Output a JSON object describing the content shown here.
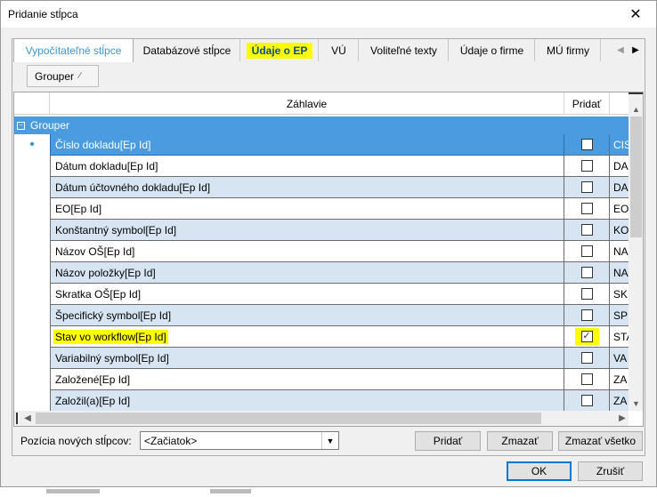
{
  "window": {
    "title": "Pridanie stĺpca"
  },
  "tabs": [
    {
      "label": "Vypočítateľné stĺpce"
    },
    {
      "label": "Databázové stĺpce"
    },
    {
      "label": "Údaje o EP"
    },
    {
      "label": "VÚ"
    },
    {
      "label": "Voliteľné texty"
    },
    {
      "label": "Údaje o firme"
    },
    {
      "label": "MÚ firmy"
    }
  ],
  "grouper_chip": {
    "label": "Grouper"
  },
  "grid": {
    "columns": {
      "header": "Záhlavie",
      "add": "Pridať"
    },
    "group_name": "Grouper",
    "rows": [
      {
        "header": "Číslo dokladu[Ep Id]",
        "code": "CIS",
        "checked": false
      },
      {
        "header": "Dátum dokladu[Ep Id]",
        "code": "DA",
        "checked": false
      },
      {
        "header": "Dátum účtovného dokladu[Ep Id]",
        "code": "DA",
        "checked": false
      },
      {
        "header": "EO[Ep Id]",
        "code": "EO",
        "checked": false
      },
      {
        "header": "Konštantný symbol[Ep Id]",
        "code": "KO",
        "checked": false
      },
      {
        "header": "Názov OŠ[Ep Id]",
        "code": "NA",
        "checked": false
      },
      {
        "header": "Názov položky[Ep Id]",
        "code": "NA",
        "checked": false
      },
      {
        "header": "Skratka OŠ[Ep Id]",
        "code": "SKR",
        "checked": false
      },
      {
        "header": "Špecifický symbol[Ep Id]",
        "code": "SP",
        "checked": false
      },
      {
        "header": "Stav vo workflow[Ep Id]",
        "code": "STA",
        "checked": true
      },
      {
        "header": "Variabilný symbol[Ep Id]",
        "code": "VA",
        "checked": false
      },
      {
        "header": "Založené[Ep Id]",
        "code": "ZA",
        "checked": false
      },
      {
        "header": "Založil(a)[Ep Id]",
        "code": "ZA",
        "checked": false
      }
    ]
  },
  "footer": {
    "position_label": "Pozícia nových stĺpcov:",
    "position_value": "<Začiatok>",
    "add_label": "Pridať",
    "delete_label": "Zmazať",
    "delete_all_label": "Zmazať všetko",
    "ok_label": "OK",
    "cancel_label": "Zrušiť"
  },
  "colors": {
    "selection": "#4a9be0",
    "alt_row": "#d7e5f3",
    "highlight": "#ffff00"
  }
}
